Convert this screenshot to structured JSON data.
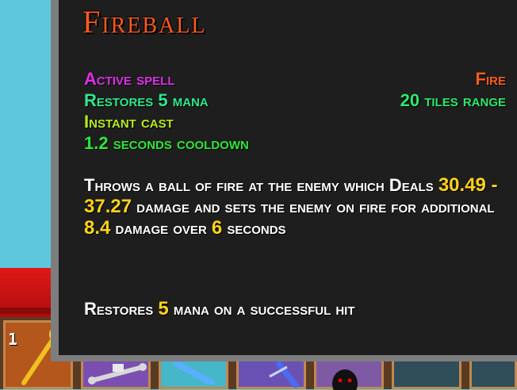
{
  "hotbar": {
    "slot_number": "1"
  },
  "tooltip": {
    "name": "Fireball",
    "spell_type": "Active spell",
    "element": "Fire",
    "mana": "Restores 5 mana",
    "range": "20 tiles range",
    "cast": "Instant cast",
    "cooldown": "1.2 seconds cooldown",
    "description": {
      "p1": "Throws a ball of fire at the enemy which Deals ",
      "damage": "30.49 - 37.27",
      "p2": " damage and sets the enemy on fire for additional ",
      "burn": "8.4",
      "p3": " damage over ",
      "seconds": "6",
      "p4": " seconds"
    },
    "restore": {
      "p1": "Restores ",
      "amount": "5",
      "p2": " mana on a successful hit"
    }
  },
  "colors": {
    "title": "#ff5a1f",
    "spell_type": "#e02ee8",
    "element": "#ff5c1c",
    "mana": "#2ee88a",
    "cast": "#b6ea1e",
    "highlight": "#ffd21a"
  },
  "icons": [
    "fire-wand-icon",
    "bone-icon",
    "blue-item-icon",
    "wand-icon",
    "ghost-icon"
  ]
}
